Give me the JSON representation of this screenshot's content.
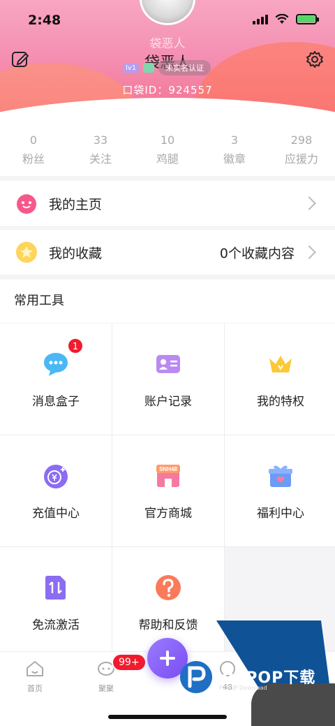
{
  "status_bar": {
    "time": "2:48"
  },
  "profile": {
    "name_ghost": "袋恶人",
    "name": "袋恶人",
    "level": "lv1",
    "verify_label": "未实名认证",
    "pocket_id": "口袋ID：924557"
  },
  "stats": [
    {
      "value": "0",
      "label": "粉丝"
    },
    {
      "value": "33",
      "label": "关注"
    },
    {
      "value": "10",
      "label": "鸡腿"
    },
    {
      "value": "3",
      "label": "徽章"
    },
    {
      "value": "298",
      "label": "应援力"
    }
  ],
  "menu": {
    "homepage": {
      "label": "我的主页"
    },
    "favorites": {
      "label": "我的收藏",
      "extra": "0个收藏内容"
    }
  },
  "tools": {
    "title": "常用工具",
    "items": [
      {
        "label": "消息盒子",
        "badge": "1",
        "icon": "chat-bubble-icon"
      },
      {
        "label": "账户记录",
        "icon": "id-card-icon"
      },
      {
        "label": "我的特权",
        "icon": "crown-icon"
      },
      {
        "label": "充值中心",
        "icon": "coin-plus-icon"
      },
      {
        "label": "官方商城",
        "icon": "shop-icon",
        "sign": "SNH48"
      },
      {
        "label": "福利中心",
        "icon": "gift-icon"
      },
      {
        "label": "免流激活",
        "icon": "data-transfer-icon"
      },
      {
        "label": "帮助和反馈",
        "icon": "question-icon"
      }
    ]
  },
  "bottom_nav": {
    "home_label": "首页",
    "chat_label": "聚聚",
    "chat_badge": "99+",
    "fourth_label": "48"
  },
  "watermark": {
    "text": "PCPOP下载",
    "sub": "PCPOP Download"
  },
  "colors": {
    "accent_purple": "#7a4df0",
    "badge_red": "#f21b2d",
    "header_pink": "#f590b3"
  }
}
